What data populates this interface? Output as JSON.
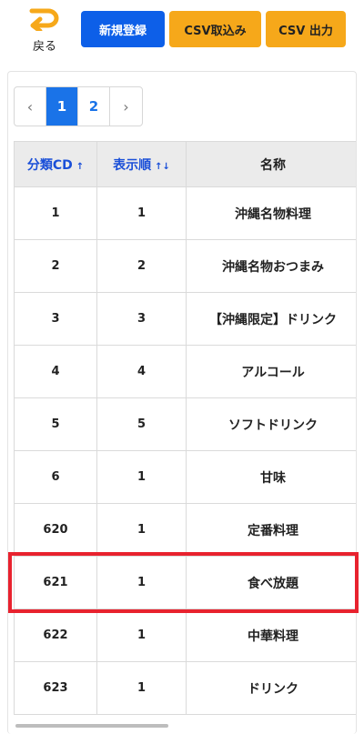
{
  "toolbar": {
    "back_label": "戻る",
    "new_label": "新規登録",
    "csv_import_label": "CSV取込み",
    "csv_export_label": "CSV 出力"
  },
  "colors": {
    "primary": "#0d5fe8",
    "csv": "#f6a81a",
    "highlight": "#e8222e",
    "link": "#1a73e8"
  },
  "pagination": {
    "prev": "‹",
    "pages": [
      "1",
      "2"
    ],
    "current": "1",
    "next": "›"
  },
  "table": {
    "headers": [
      {
        "label": "分類CD",
        "sort": "↑"
      },
      {
        "label": "表示順",
        "sort": "↑↓"
      },
      {
        "label": "名称",
        "sort": ""
      }
    ],
    "rows": [
      {
        "cd": "1",
        "order": "1",
        "name": "沖縄名物料理"
      },
      {
        "cd": "2",
        "order": "2",
        "name": "沖縄名物おつまみ"
      },
      {
        "cd": "3",
        "order": "3",
        "name": "【沖縄限定】ドリンク"
      },
      {
        "cd": "4",
        "order": "4",
        "name": "アルコール"
      },
      {
        "cd": "5",
        "order": "5",
        "name": "ソフトドリンク"
      },
      {
        "cd": "6",
        "order": "1",
        "name": "甘味"
      },
      {
        "cd": "620",
        "order": "1",
        "name": "定番料理"
      },
      {
        "cd": "621",
        "order": "1",
        "name": "食べ放題"
      },
      {
        "cd": "622",
        "order": "1",
        "name": "中華料理"
      },
      {
        "cd": "623",
        "order": "1",
        "name": "ドリンク"
      }
    ]
  }
}
